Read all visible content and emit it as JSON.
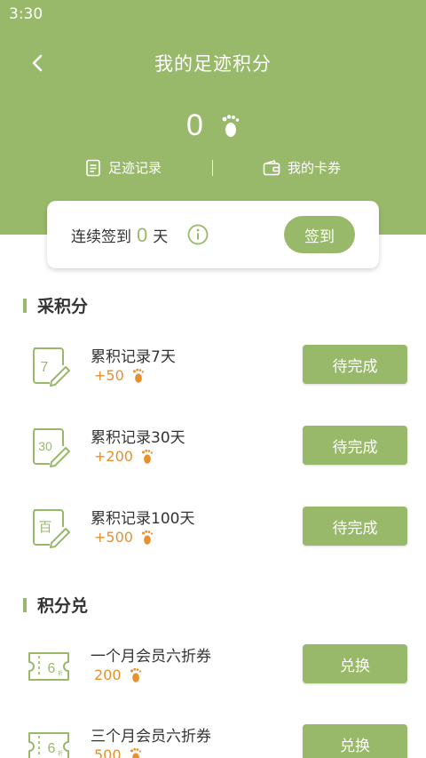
{
  "status_bar": {
    "time": "3:30"
  },
  "header": {
    "title": "我的足迹积分",
    "points": "0",
    "records_label": "足迹记录",
    "cards_label": "我的卡券"
  },
  "signin": {
    "prefix": "连续签到",
    "days": "0",
    "suffix": "天",
    "button_label": "签到"
  },
  "earn_section": {
    "title": "采积分",
    "tasks": [
      {
        "icon_label": "7",
        "name": "累积记录7天",
        "reward": "+50",
        "button_label": "待完成"
      },
      {
        "icon_label": "30",
        "name": "累积记录30天",
        "reward": "+200",
        "button_label": "待完成"
      },
      {
        "icon_label": "百",
        "name": "累积记录100天",
        "reward": "+500",
        "button_label": "待完成"
      }
    ]
  },
  "redeem_section": {
    "title": "积分兑",
    "items": [
      {
        "icon_label": "6",
        "icon_sub": "折",
        "name": "一个月会员六折券",
        "cost": "200",
        "button_label": "兑换"
      },
      {
        "icon_label": "6",
        "icon_sub": "折",
        "name": "三个月会员六折券",
        "cost": "500",
        "button_label": "兑换"
      }
    ]
  },
  "colors": {
    "brand": "#99b96a",
    "reward": "#e8902e"
  }
}
